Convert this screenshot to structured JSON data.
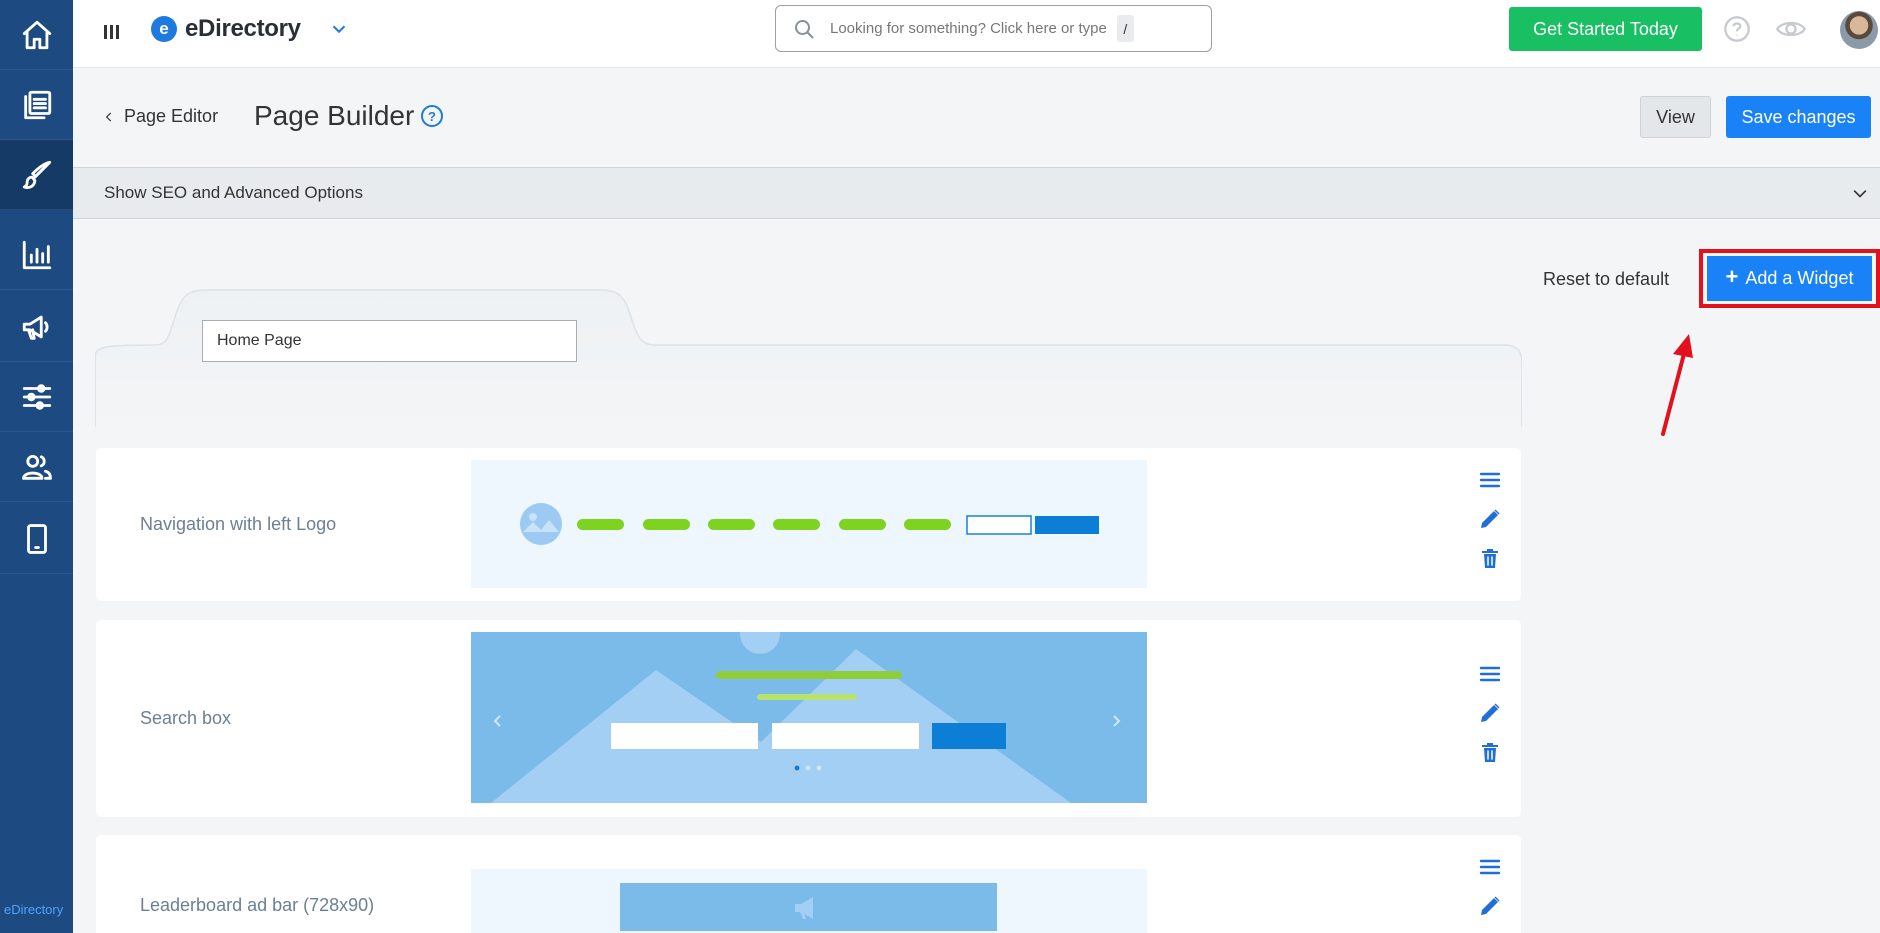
{
  "sidebar": {
    "items": [
      {
        "name": "sidebar-item-home",
        "icon": "home-icon"
      },
      {
        "name": "sidebar-item-content",
        "icon": "documents-icon"
      },
      {
        "name": "sidebar-item-design",
        "icon": "paintbrush-icon"
      },
      {
        "name": "sidebar-item-reports",
        "icon": "bar-chart-icon"
      },
      {
        "name": "sidebar-item-promote",
        "icon": "megaphone-icon"
      },
      {
        "name": "sidebar-item-settings",
        "icon": "sliders-icon"
      },
      {
        "name": "sidebar-item-users",
        "icon": "users-icon"
      },
      {
        "name": "sidebar-item-mobile",
        "icon": "mobile-icon"
      }
    ],
    "active_index": 2,
    "footer_brand": "eDirectory"
  },
  "topbar": {
    "brand_logo_letter": "e",
    "brand_name": "eDirectory",
    "search_placeholder": "Looking for something? Click here or type",
    "search_shortcut": "/",
    "cta_label": "Get Started Today",
    "cta_color": "#18c063"
  },
  "page": {
    "back_label": "Page Editor",
    "title": "Page Builder",
    "help_glyph": "?",
    "view_label": "View",
    "save_label": "Save changes",
    "seo_label": "Show SEO and Advanced Options",
    "reset_label": "Reset to default",
    "add_widget_label": "Add a Widget",
    "add_widget_glyph": "+",
    "page_name_value": "Home Page",
    "accent_color": "#1a82f7",
    "highlight_color": "#e3101d"
  },
  "widgets": [
    {
      "label": "Navigation with left Logo",
      "preview": "navigation-preview"
    },
    {
      "label": "Search box",
      "preview": "search-box-preview"
    },
    {
      "label": "Leaderboard ad bar (728x90)",
      "preview": "leaderboard-ad-preview"
    }
  ]
}
